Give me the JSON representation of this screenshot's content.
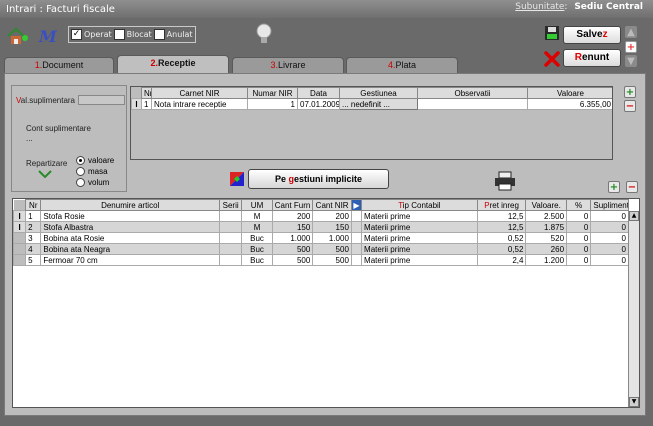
{
  "window": {
    "title": "Intrari : Facturi fiscale",
    "subunit_label": "Subunitate",
    "subunit_value": "Sediu Central"
  },
  "toolbar": {
    "checks": [
      {
        "label": "Operat",
        "checked": true
      },
      {
        "label": "Blocat",
        "checked": false
      },
      {
        "label": "Anulat",
        "checked": false
      }
    ],
    "save_hl": "Salve",
    "save_red": "z",
    "cancel_red": "R",
    "cancel_rest": "enunt"
  },
  "tabs": [
    {
      "num": "1.",
      "label": "Document"
    },
    {
      "num": "2.",
      "label": "Receptie"
    },
    {
      "num": "3.",
      "label": "Livrare"
    },
    {
      "num": "4.",
      "label": "Plata"
    }
  ],
  "left": {
    "val_sup_red": "V",
    "val_sup_rest": "al.suplimentara",
    "cont_sup": "Cont suplimentare",
    "cont_val": "...",
    "repartizare": "Repartizare",
    "radios": [
      "valoare",
      "masa",
      "volum"
    ]
  },
  "nir": {
    "headers": [
      "Nr",
      "Carnet NIR",
      "Numar NIR",
      "Data",
      "Gestiunea",
      "Observatii",
      "Valoare"
    ],
    "rows": [
      {
        "nr": "1",
        "carnet": "Nota intrare receptie",
        "numar": "1",
        "data": "07.01.2009",
        "gest": "... nedefinit ...",
        "obs": "",
        "valoare": "6.355,00"
      }
    ]
  },
  "gest_button": {
    "pre": "Pe ",
    "red": "g",
    "rest": "estiuni implicite"
  },
  "articles": {
    "headers": {
      "nr": "Nr",
      "den": "Denumire articol",
      "serii": "Serii",
      "um": "UM",
      "cf": "Cant Furn",
      "cn": "Cant NIR",
      "tip_red": "T",
      "tip_rest": "ip Contabil",
      "pret_red": "P",
      "pret_rest": "ret inreg",
      "val": "Valoare.",
      "pct": "%",
      "supl": "Supliment"
    },
    "rows": [
      {
        "nr": "1",
        "den": "Stofa Rosie",
        "um": "M",
        "cf": "200",
        "cn": "200",
        "tip": "Materii prime",
        "pret": "12,5",
        "val": "2.500",
        "pct": "0",
        "supl": "0"
      },
      {
        "nr": "2",
        "den": "Stofa Albastra",
        "um": "M",
        "cf": "150",
        "cn": "150",
        "tip": "Materii prime",
        "pret": "12,5",
        "val": "1.875",
        "pct": "0",
        "supl": "0"
      },
      {
        "nr": "3",
        "den": "Bobina ata Rosie",
        "um": "Buc",
        "cf": "1.000",
        "cn": "1.000",
        "tip": "Materii prime",
        "pret": "0,52",
        "val": "520",
        "pct": "0",
        "supl": "0"
      },
      {
        "nr": "4",
        "den": "Bobina ata Neagra",
        "um": "Buc",
        "cf": "500",
        "cn": "500",
        "tip": "Materii prime",
        "pret": "0,52",
        "val": "260",
        "pct": "0",
        "supl": "0"
      },
      {
        "nr": "5",
        "den": "Fermoar 70 cm",
        "um": "Buc",
        "cf": "500",
        "cn": "500",
        "tip": "Materii prime",
        "pret": "2,4",
        "val": "1.200",
        "pct": "0",
        "supl": "0"
      }
    ]
  }
}
